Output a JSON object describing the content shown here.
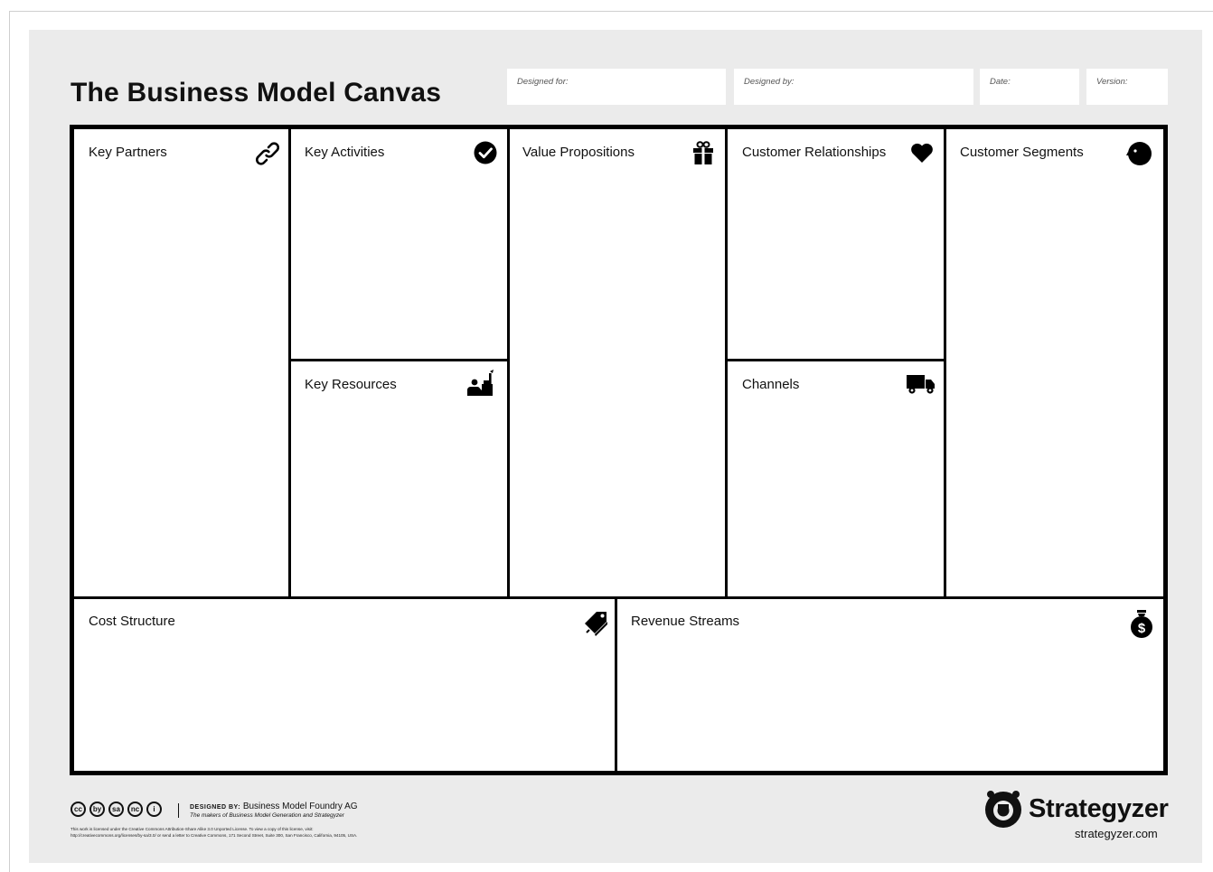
{
  "title": "The Business Model Canvas",
  "meta": {
    "designed_for": "Designed for:",
    "designed_by": "Designed by:",
    "date": "Date:",
    "version": "Version:"
  },
  "blocks": {
    "key_partners": "Key Partners",
    "key_activities": "Key Activities",
    "key_resources": "Key Resources",
    "value_propositions": "Value Propositions",
    "customer_relationships": "Customer Relationships",
    "channels": "Channels",
    "customer_segments": "Customer Segments",
    "cost_structure": "Cost Structure",
    "revenue_streams": "Revenue Streams"
  },
  "icons": {
    "key_partners": "link-icon",
    "key_activities": "checkmark-icon",
    "key_resources": "worker-icon",
    "value_propositions": "gift-icon",
    "customer_relationships": "heart-icon",
    "channels": "truck-icon",
    "customer_segments": "head-icon",
    "cost_structure": "price-tag-icon",
    "revenue_streams": "money-bag-icon"
  },
  "footer": {
    "cc_icons": [
      "cc",
      "by",
      "sa",
      "nc",
      "i"
    ],
    "designed_by_key": "DESIGNED BY:",
    "designed_by_value": "Business Model Foundry AG",
    "makers": "The makers of Business Model Generation and Strategyzer",
    "license_line1": "This work is licensed under the Creative Commons Attribution-Share Alike 3.0 Unported License. To view a copy of this license, visit:",
    "license_line2": "http://creativecommons.org/licenses/by-sa/3.0/ or send a letter to Creative Commons, 171 Second Street, Suite 300, San Francisco, California, 94105, USA.",
    "brand_name": "Strategyzer",
    "brand_url": "strategyzer.com"
  }
}
